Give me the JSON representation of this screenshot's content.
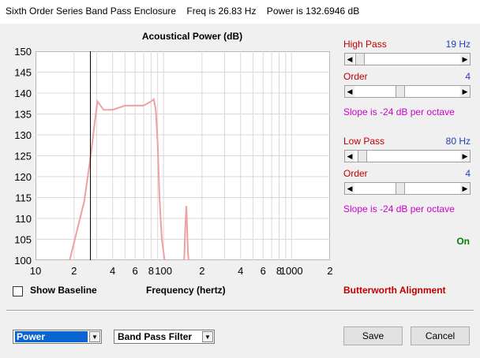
{
  "window": {
    "title": "Sixth Order Series Band Pass Enclosure    Freq is 26.83 Hz    Power is 132.6946 dB"
  },
  "chart_data": {
    "type": "line",
    "title": "Acoustical Power (dB)",
    "xlabel": "Frequency (hertz)",
    "ylabel": "",
    "x_scale": "log",
    "xlim": [
      10,
      2000
    ],
    "ylim": [
      100,
      150
    ],
    "x_ticks": [
      "10",
      "2",
      "4",
      "6",
      "8",
      "100",
      "2",
      "4",
      "6",
      "8",
      "1000",
      "2"
    ],
    "y_ticks": [
      "150",
      "145",
      "140",
      "135",
      "130",
      "125",
      "120",
      "115",
      "110",
      "105",
      "100"
    ],
    "cursor_x": 26.83,
    "series": [
      {
        "color": "#f0a0a0",
        "x": [
          18.5,
          24,
          27,
          29,
          30.5,
          34,
          40,
          50,
          60,
          70,
          80,
          84,
          87,
          90,
          93,
          97,
          102
        ],
        "y": [
          100,
          114,
          125,
          133,
          138,
          136,
          136,
          137,
          137,
          137,
          138,
          138.5,
          136,
          128,
          115,
          105,
          100
        ]
      },
      {
        "color": "#f0a0a0",
        "x": [
          145,
          148,
          151,
          153,
          155,
          157
        ],
        "y": [
          100,
          108,
          113,
          108,
          102,
          100
        ]
      }
    ]
  },
  "controls": {
    "high_pass_label": "High Pass",
    "high_pass_value": "19 Hz",
    "hp_order_label": "Order",
    "hp_order_value": "4",
    "hp_slope": "Slope is -24 dB per octave",
    "low_pass_label": "Low Pass",
    "low_pass_value": "80 Hz",
    "lp_order_label": "Order",
    "lp_order_value": "4",
    "lp_slope": "Slope is -24 dB per octave",
    "status": "On",
    "alignment": "Butterworth Alignment",
    "show_baseline": "Show Baseline",
    "show_baseline_checked": false
  },
  "footer": {
    "mode_select": "Power",
    "filter_select": "Band Pass Filter",
    "save_label": "Save",
    "cancel_label": "Cancel"
  }
}
